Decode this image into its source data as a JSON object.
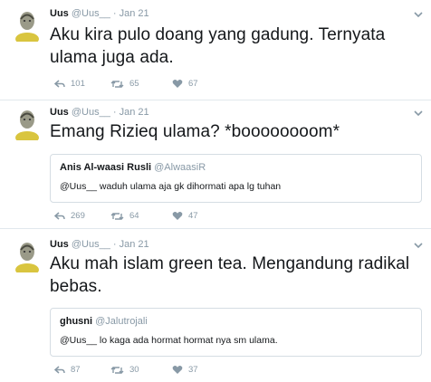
{
  "tweets": [
    {
      "name": "Uus",
      "handle": "@Uus__",
      "sep": "·",
      "date": "Jan 21",
      "text": "Aku kira pulo doang yang gadung. Ternyata ulama juga ada.",
      "reply": "101",
      "retweet": "65",
      "like": "67"
    },
    {
      "name": "Uus",
      "handle": "@Uus__",
      "sep": "·",
      "date": "Jan 21",
      "text": "Emang Rizieq ulama? *boooooooom*",
      "quote": {
        "name": "Anis Al-waasi Rusli",
        "handle": "@AlwaasiR",
        "text": "@Uus__ waduh ulama aja gk dihormati apa lg tuhan"
      },
      "reply": "269",
      "retweet": "64",
      "like": "47"
    },
    {
      "name": "Uus",
      "handle": "@Uus__",
      "sep": "·",
      "date": "Jan 21",
      "text": "Aku mah islam green tea. Mengandung radikal bebas.",
      "quote": {
        "name": "ghusni",
        "handle": "@Jalutrojali",
        "text": "@Uus__ lo kaga ada hormat hormat nya sm ulama."
      },
      "reply": "87",
      "retweet": "30",
      "like": "37"
    }
  ],
  "icons": {
    "reply": "reply-icon",
    "retweet": "retweet-icon",
    "like": "heart-icon",
    "more": "chevron-down-icon"
  },
  "colors": {
    "text": "#14171a",
    "muted": "#8899a6",
    "border": "#e1e8ed"
  }
}
